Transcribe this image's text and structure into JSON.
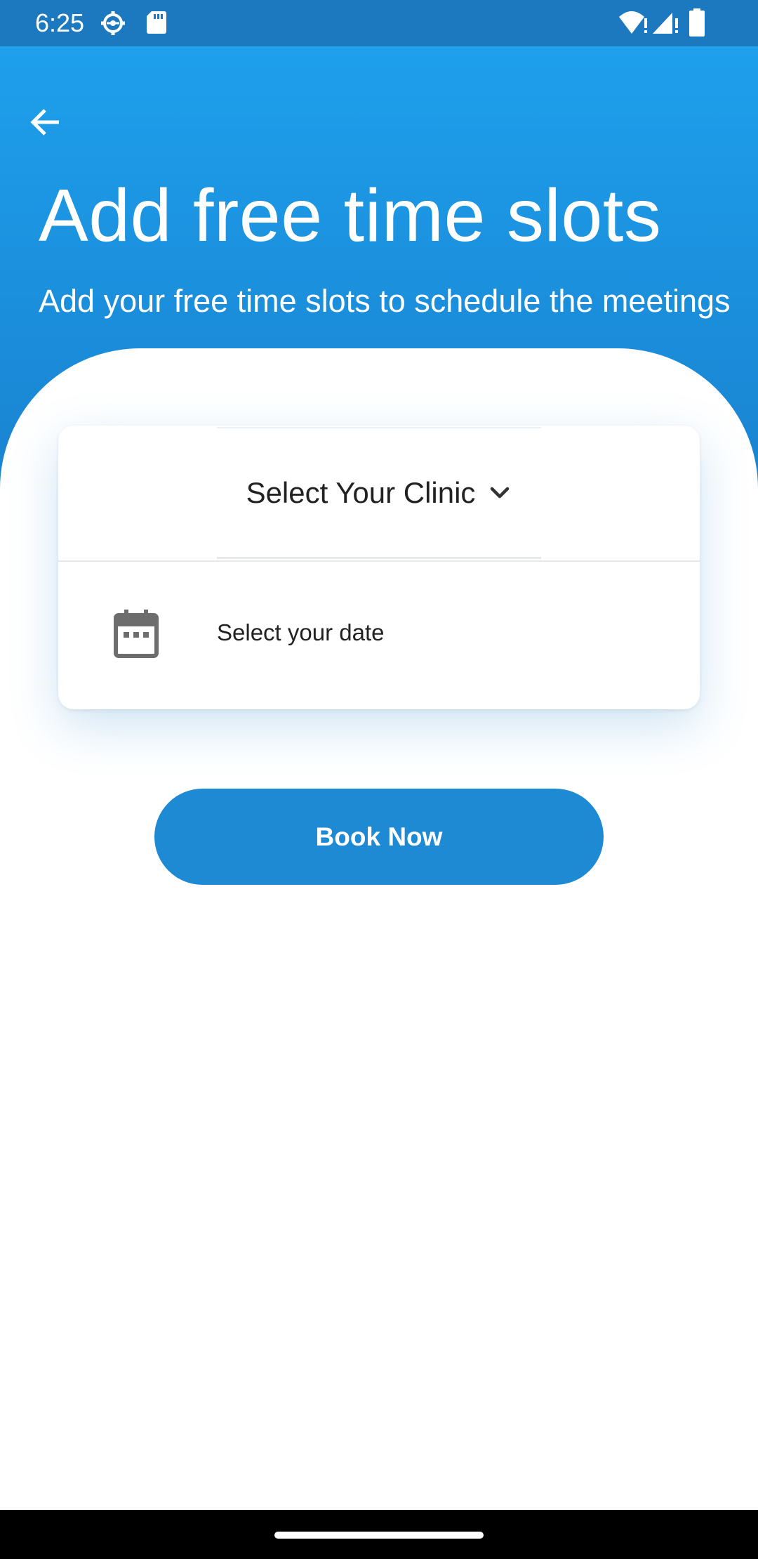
{
  "status_bar": {
    "time": "6:25",
    "icons": [
      "settings-icon",
      "sd-card-icon",
      "wifi-alert-icon",
      "signal-alert-icon",
      "battery-icon"
    ]
  },
  "header": {
    "back_icon": "arrow-left-icon",
    "title": "Add free time slots",
    "subtitle": "Add your free time slots to schedule the meetings"
  },
  "form": {
    "clinic_select": {
      "label": "Select Your Clinic",
      "icon": "chevron-down-icon"
    },
    "date_picker": {
      "label": "Select your date",
      "icon": "calendar-icon"
    }
  },
  "actions": {
    "book_label": "Book Now"
  },
  "colors": {
    "header_top": "#1ea0ec",
    "header_bottom": "#1a82cf",
    "status_bar": "#1d79bf",
    "button": "#1d8ad3"
  }
}
